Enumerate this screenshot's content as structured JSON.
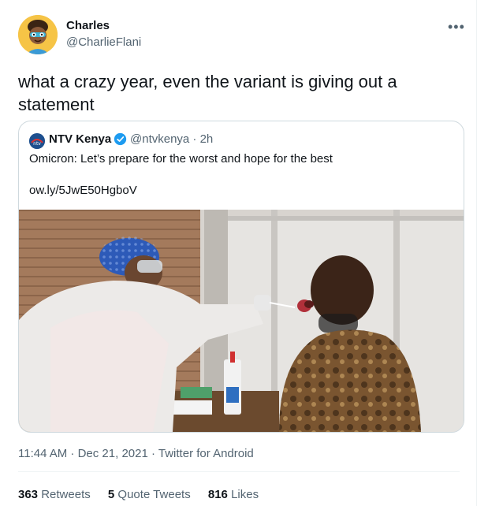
{
  "author": {
    "name": "Charles",
    "handle": "@CharlieFlani",
    "avatar_icon": "cartoon-avatar"
  },
  "more_icon": "more-horizontal-icon",
  "tweet_text": "what a crazy year, even the variant is giving out a statement",
  "quote": {
    "name": "NTV Kenya",
    "verified_icon": "verified-badge-icon",
    "handle_time": "@ntvkenya · 2h",
    "text": "Omicron: Let’s prepare for the worst and hope for the best",
    "link": "ow.ly/5JwE50HgboV",
    "image_icon": "covid-test-photo"
  },
  "meta": {
    "time_date": "11:44 AM · Dec 21, 2021 · ",
    "source": "Twitter for Android"
  },
  "stats": {
    "retweets_count": "363",
    "retweets_label": "Retweets",
    "quotes_count": "5",
    "quotes_label": "Quote Tweets",
    "likes_count": "816",
    "likes_label": "Likes"
  },
  "colors": {
    "verified": "#1d9bf0",
    "secondary_text": "#536471",
    "primary_text": "#0f1419",
    "border": "#cfd9de"
  }
}
